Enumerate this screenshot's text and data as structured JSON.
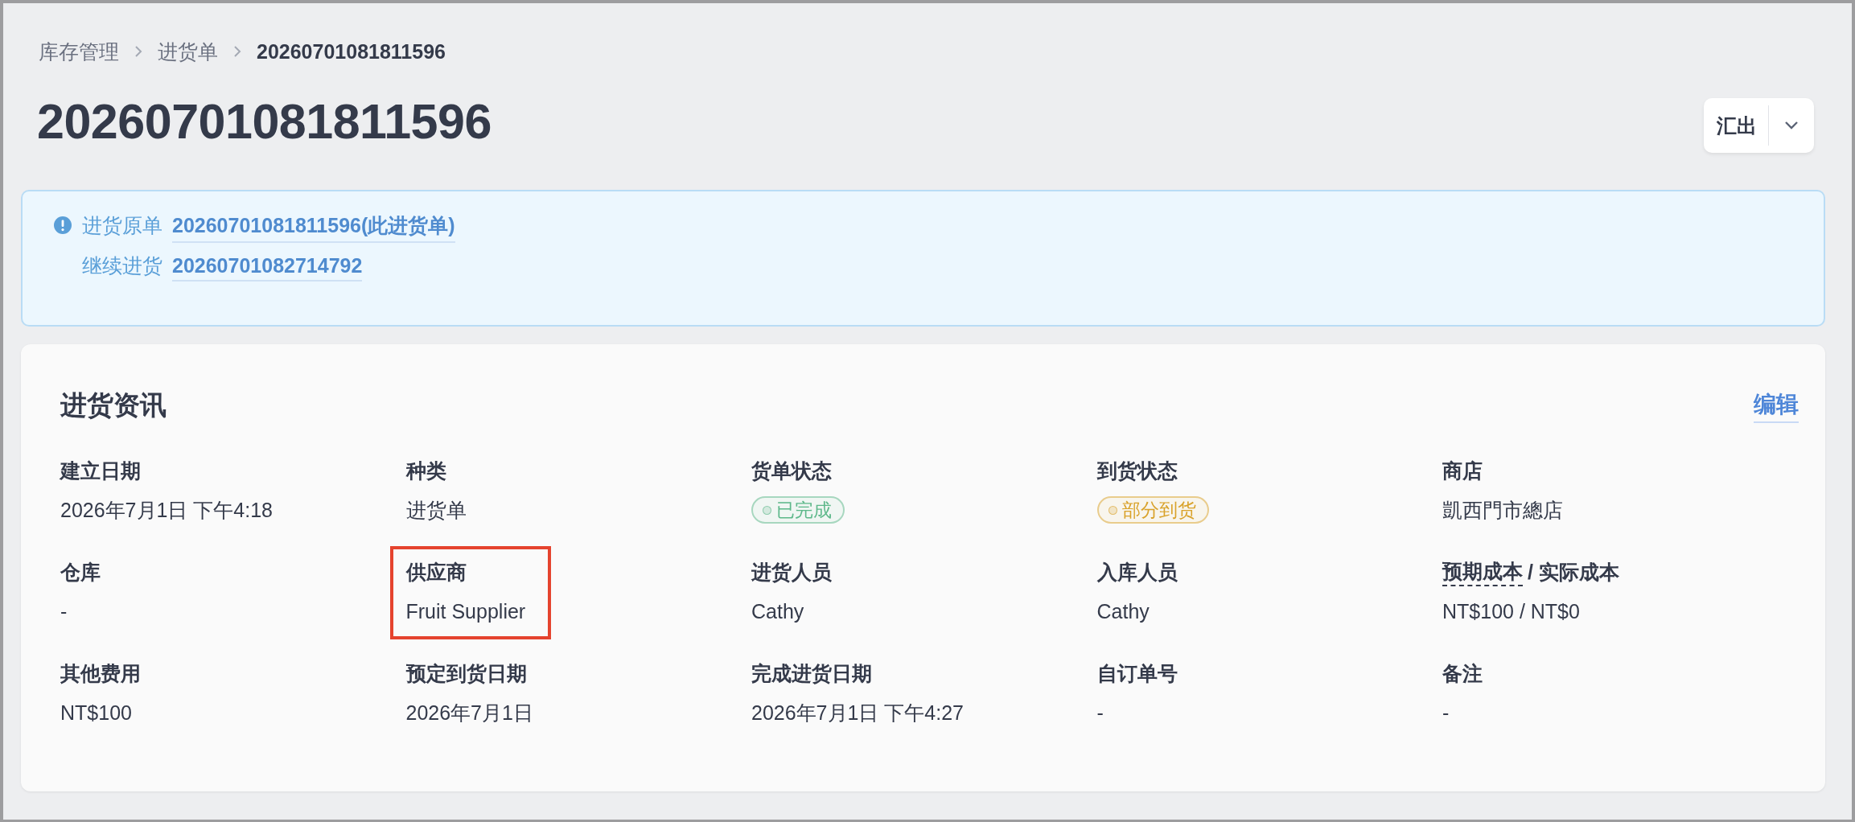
{
  "breadcrumb": [
    {
      "label": "库存管理",
      "current": false
    },
    {
      "label": "进货单",
      "current": false
    },
    {
      "label": "20260701081811596",
      "current": true
    }
  ],
  "title": "20260701081811596",
  "export_button": {
    "label": "汇出"
  },
  "notice": {
    "rows": [
      {
        "label": "进货原单",
        "link": "20260701081811596(此进货单)"
      },
      {
        "label": "继续进货",
        "link": "20260701082714792"
      }
    ]
  },
  "info_card": {
    "title": "进货资讯",
    "edit_link": "编辑",
    "fields": [
      {
        "label_parts": [
          {
            "text": "建立日期",
            "dashed": false
          }
        ],
        "kind": "text",
        "value": "2026年7月1日 下午4:18",
        "highlighted": false
      },
      {
        "label_parts": [
          {
            "text": "种类",
            "dashed": false
          }
        ],
        "kind": "text",
        "value": "进货单",
        "highlighted": false
      },
      {
        "label_parts": [
          {
            "text": "货单状态",
            "dashed": false
          }
        ],
        "kind": "badge",
        "value": "已完成",
        "color": "#5db88a",
        "highlighted": false
      },
      {
        "label_parts": [
          {
            "text": "到货状态",
            "dashed": false
          }
        ],
        "kind": "badge",
        "value": "部分到货",
        "color": "#d9a22a",
        "highlighted": false
      },
      {
        "label_parts": [
          {
            "text": "商店",
            "dashed": false
          }
        ],
        "kind": "text",
        "value": "凱西門市總店",
        "highlighted": false
      },
      {
        "label_parts": [
          {
            "text": "仓库",
            "dashed": false
          }
        ],
        "kind": "text",
        "value": "-",
        "highlighted": false
      },
      {
        "label_parts": [
          {
            "text": "供应商",
            "dashed": false
          }
        ],
        "kind": "text",
        "value": "Fruit Supplier",
        "highlighted": true
      },
      {
        "label_parts": [
          {
            "text": "进货人员",
            "dashed": false
          }
        ],
        "kind": "text",
        "value": "Cathy",
        "highlighted": false
      },
      {
        "label_parts": [
          {
            "text": "入库人员",
            "dashed": false
          }
        ],
        "kind": "text",
        "value": "Cathy",
        "highlighted": false
      },
      {
        "label_parts": [
          {
            "text": "预期成本",
            "dashed": true
          },
          {
            "text": "/ 实际成本",
            "dashed": false
          }
        ],
        "kind": "text",
        "value": "NT$100 / NT$0",
        "highlighted": false
      },
      {
        "label_parts": [
          {
            "text": "其他费用",
            "dashed": false
          }
        ],
        "kind": "text",
        "value": "NT$100",
        "highlighted": false
      },
      {
        "label_parts": [
          {
            "text": "预定到货日期",
            "dashed": false
          }
        ],
        "kind": "text",
        "value": "2026年7月1日",
        "highlighted": false
      },
      {
        "label_parts": [
          {
            "text": "完成进货日期",
            "dashed": false
          }
        ],
        "kind": "text",
        "value": "2026年7月1日 下午4:27",
        "highlighted": false
      },
      {
        "label_parts": [
          {
            "text": "自订单号",
            "dashed": false
          }
        ],
        "kind": "text",
        "value": "-",
        "highlighted": false
      },
      {
        "label_parts": [
          {
            "text": "备注",
            "dashed": false
          }
        ],
        "kind": "text",
        "value": "-",
        "highlighted": false
      }
    ]
  }
}
